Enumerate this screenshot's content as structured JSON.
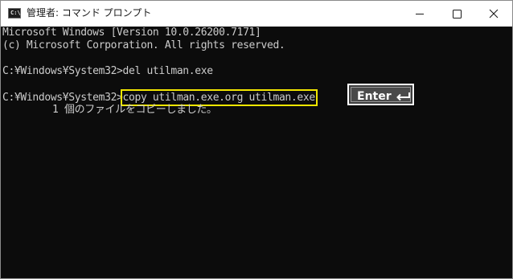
{
  "window": {
    "title": "管理者: コマンド プロンプト",
    "icon": "console-icon",
    "icon_glyph": "C:\\"
  },
  "controls": {
    "minimize_icon": "minimize-icon",
    "maximize_icon": "maximize-icon",
    "close_icon": "close-icon"
  },
  "console": {
    "lines": [
      "Microsoft Windows [Version 10.0.26200.7171]",
      "(c) Microsoft Corporation. All rights reserved.",
      "C:¥Windows¥System32>del utilman.exe"
    ],
    "prompt": "C:¥Windows¥System32>",
    "command": "copy utilman.exe.org utilman.exe",
    "output": "1 個のファイルをコピーしました。"
  },
  "annotation": {
    "enter_label": "Enter",
    "enter_icon": "return-arrow-icon",
    "highlight_color": "#f2e600"
  },
  "colors": {
    "console_bg": "#0c0c0c",
    "console_fg": "#cccccc",
    "titlebar_bg": "#ffffff"
  }
}
